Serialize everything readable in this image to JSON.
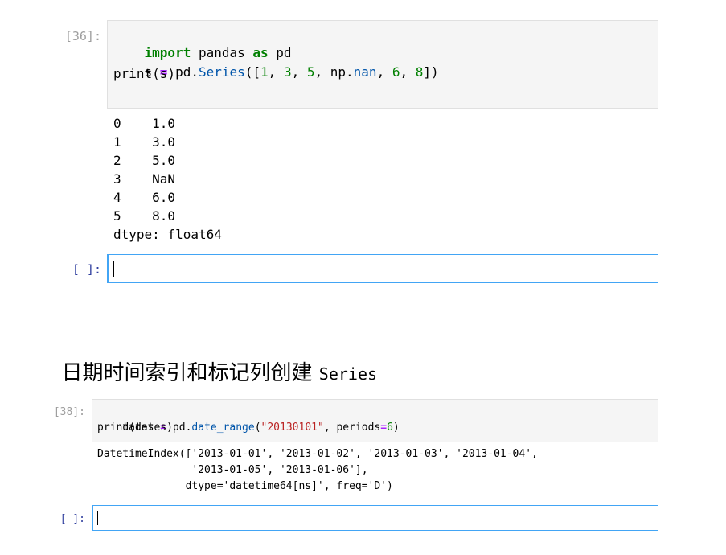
{
  "cell36": {
    "prompt": "[36]:",
    "code": {
      "l1_kw_import": "import",
      "l1_mod": " pandas ",
      "l1_kw_as": "as",
      "l1_alias": " pd",
      "l2_var": "s ",
      "l2_eq": "=",
      "l2_pd": " pd.",
      "l2_series": "Series",
      "l2_open": "([",
      "n1": "1",
      "c1": ", ",
      "n3": "3",
      "c2": ", ",
      "n5": "5",
      "c3": ", np.",
      "nan": "nan",
      "c4": ", ",
      "n6": "6",
      "c5": ", ",
      "n8": "8",
      "l2_close": "])",
      "l3": "print(s)"
    },
    "output": [
      "0    1.0",
      "1    3.0",
      "2    5.0",
      "3    NaN",
      "4    6.0",
      "5    8.0",
      "dtype: float64"
    ]
  },
  "cell_empty_1": {
    "prompt": "[ ]:"
  },
  "heading": {
    "text": "日期时间索引和标记列创建 ",
    "mono": "Series"
  },
  "cell38": {
    "prompt": "[38]:",
    "code": {
      "l1_var": "dates ",
      "l1_eq": "=",
      "l1_pd": " pd.",
      "l1_func": "date_range",
      "l1_open": "(",
      "l1_str": "\"20130101\"",
      "l1_mid": ", periods",
      "l1_eq2": "=",
      "l1_num": "6",
      "l1_close": ")",
      "l2": "print(dates)"
    },
    "output": [
      "DatetimeIndex(['2013-01-01', '2013-01-02', '2013-01-03', '2013-01-04',",
      "               '2013-01-05', '2013-01-06'],",
      "              dtype='datetime64[ns]', freq='D')"
    ]
  },
  "cell_empty_2": {
    "prompt": "[ ]:"
  }
}
